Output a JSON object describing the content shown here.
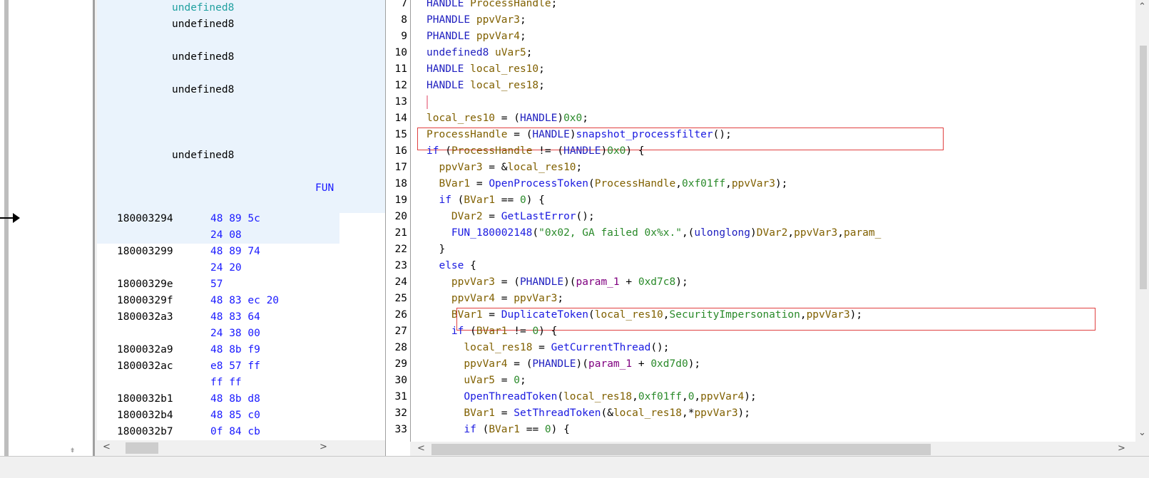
{
  "listing": {
    "rows": [
      {
        "text": "undefined8",
        "kind": "undef",
        "hl": true,
        "colored": true
      },
      {
        "text": "undefined8",
        "kind": "undef",
        "hl": true
      },
      {
        "text": "",
        "kind": "blank",
        "hl": true
      },
      {
        "text": "undefined8",
        "kind": "undef",
        "hl": true
      },
      {
        "text": "",
        "kind": "blank",
        "hl": true
      },
      {
        "text": "undefined8",
        "kind": "undef",
        "hl": true
      },
      {
        "text": "",
        "kind": "blank",
        "hl": true
      },
      {
        "text": "",
        "kind": "blank",
        "hl": true
      },
      {
        "text": "",
        "kind": "blank",
        "hl": true
      },
      {
        "text": "undefined8",
        "kind": "undef",
        "hl": true
      },
      {
        "text": "",
        "kind": "blank",
        "hl": true
      },
      {
        "text": "FUN",
        "kind": "fun",
        "hl": true
      },
      {
        "text": "",
        "kind": "blank",
        "hl": true
      }
    ],
    "instructions": [
      {
        "addr": "180003294",
        "bytes": "48 89 5c",
        "hl": true
      },
      {
        "addr": "",
        "bytes": "24 08",
        "hl": true
      },
      {
        "addr": "180003299",
        "bytes": "48 89 74",
        "hl": false
      },
      {
        "addr": "",
        "bytes": "24 20",
        "hl": false
      },
      {
        "addr": "18000329e",
        "bytes": "57",
        "hl": false
      },
      {
        "addr": "18000329f",
        "bytes": "48 83 ec 20",
        "hl": false
      },
      {
        "addr": "1800032a3",
        "bytes": "48 83 64",
        "hl": false
      },
      {
        "addr": "",
        "bytes": "24 38 00",
        "hl": false
      },
      {
        "addr": "1800032a9",
        "bytes": "48 8b f9",
        "hl": false
      },
      {
        "addr": "1800032ac",
        "bytes": "e8 57 ff",
        "hl": false
      },
      {
        "addr": "",
        "bytes": "ff ff",
        "hl": false
      },
      {
        "addr": "1800032b1",
        "bytes": "48 8b d8",
        "hl": false
      },
      {
        "addr": "1800032b4",
        "bytes": "48 85 c0",
        "hl": false
      },
      {
        "addr": "1800032b7",
        "bytes": "0f 84 cb",
        "hl": false
      }
    ]
  },
  "decompiler": {
    "lines": [
      {
        "n": "7",
        "parts": [
          [
            "t",
            "HANDLE "
          ],
          [
            "v",
            "ProcessHandle"
          ],
          [
            "p",
            ";"
          ]
        ]
      },
      {
        "n": "8",
        "parts": [
          [
            "t",
            "PHANDLE "
          ],
          [
            "v",
            "ppvVar3"
          ],
          [
            "p",
            ";"
          ]
        ]
      },
      {
        "n": "9",
        "parts": [
          [
            "t",
            "PHANDLE "
          ],
          [
            "v",
            "ppvVar4"
          ],
          [
            "p",
            ";"
          ]
        ]
      },
      {
        "n": "10",
        "parts": [
          [
            "t",
            "undefined8 "
          ],
          [
            "v",
            "uVar5"
          ],
          [
            "p",
            ";"
          ]
        ]
      },
      {
        "n": "11",
        "parts": [
          [
            "t",
            "HANDLE "
          ],
          [
            "v",
            "local_res10"
          ],
          [
            "p",
            ";"
          ]
        ]
      },
      {
        "n": "12",
        "parts": [
          [
            "t",
            "HANDLE "
          ],
          [
            "v",
            "local_res18"
          ],
          [
            "p",
            ";"
          ]
        ]
      },
      {
        "n": "13",
        "parts": []
      },
      {
        "n": "14",
        "parts": [
          [
            "v",
            "local_res10"
          ],
          [
            "p",
            " = ("
          ],
          [
            "t",
            "HANDLE"
          ],
          [
            "p",
            ")"
          ],
          [
            "n",
            "0x0"
          ],
          [
            "p",
            ";"
          ]
        ]
      },
      {
        "n": "15",
        "parts": [
          [
            "v",
            "ProcessHandle"
          ],
          [
            "p",
            " = ("
          ],
          [
            "t",
            "HANDLE"
          ],
          [
            "p",
            ")"
          ],
          [
            "f",
            "snapshot_processfilter"
          ],
          [
            "p",
            "();"
          ]
        ]
      },
      {
        "n": "16",
        "parts": [
          [
            "k",
            "if "
          ],
          [
            "p",
            "("
          ],
          [
            "v",
            "ProcessHandle"
          ],
          [
            "p",
            " != ("
          ],
          [
            "t",
            "HANDLE"
          ],
          [
            "p",
            ")"
          ],
          [
            "n",
            "0x0"
          ],
          [
            "p",
            ") {"
          ]
        ]
      },
      {
        "n": "17",
        "parts": [
          [
            "p",
            "  "
          ],
          [
            "v",
            "ppvVar3"
          ],
          [
            "p",
            " = &"
          ],
          [
            "v",
            "local_res10"
          ],
          [
            "p",
            ";"
          ]
        ]
      },
      {
        "n": "18",
        "parts": [
          [
            "p",
            "  "
          ],
          [
            "v",
            "BVar1"
          ],
          [
            "p",
            " = "
          ],
          [
            "f",
            "OpenProcessToken"
          ],
          [
            "p",
            "("
          ],
          [
            "v",
            "ProcessHandle"
          ],
          [
            "p",
            ","
          ],
          [
            "n",
            "0xf01ff"
          ],
          [
            "p",
            ","
          ],
          [
            "v",
            "ppvVar3"
          ],
          [
            "p",
            ");"
          ]
        ]
      },
      {
        "n": "19",
        "parts": [
          [
            "p",
            "  "
          ],
          [
            "k",
            "if "
          ],
          [
            "p",
            "("
          ],
          [
            "v",
            "BVar1"
          ],
          [
            "p",
            " == "
          ],
          [
            "n",
            "0"
          ],
          [
            "p",
            ") {"
          ]
        ]
      },
      {
        "n": "20",
        "parts": [
          [
            "p",
            "    "
          ],
          [
            "v",
            "DVar2"
          ],
          [
            "p",
            " = "
          ],
          [
            "f",
            "GetLastError"
          ],
          [
            "p",
            "();"
          ]
        ]
      },
      {
        "n": "21",
        "parts": [
          [
            "p",
            "    "
          ],
          [
            "f",
            "FUN_180002148"
          ],
          [
            "p",
            "("
          ],
          [
            "s",
            "\"0x02, GA failed 0x%x.\""
          ],
          [
            "p",
            ",("
          ],
          [
            "t",
            "ulonglong"
          ],
          [
            "p",
            ")"
          ],
          [
            "v",
            "DVar2"
          ],
          [
            "p",
            ","
          ],
          [
            "v",
            "ppvVar3"
          ],
          [
            "p",
            ","
          ],
          [
            "v",
            "param_"
          ]
        ]
      },
      {
        "n": "22",
        "parts": [
          [
            "p",
            "  }"
          ]
        ]
      },
      {
        "n": "23",
        "parts": [
          [
            "p",
            "  "
          ],
          [
            "k",
            "else "
          ],
          [
            "p",
            "{"
          ]
        ]
      },
      {
        "n": "24",
        "parts": [
          [
            "p",
            "    "
          ],
          [
            "v",
            "ppvVar3"
          ],
          [
            "p",
            " = ("
          ],
          [
            "t",
            "PHANDLE"
          ],
          [
            "p",
            ")("
          ],
          [
            "pv",
            "param_1"
          ],
          [
            "p",
            " + "
          ],
          [
            "n",
            "0xd7c8"
          ],
          [
            "p",
            ");"
          ]
        ]
      },
      {
        "n": "25",
        "parts": [
          [
            "p",
            "    "
          ],
          [
            "v",
            "ppvVar4"
          ],
          [
            "p",
            " = "
          ],
          [
            "v",
            "ppvVar3"
          ],
          [
            "p",
            ";"
          ]
        ]
      },
      {
        "n": "26",
        "parts": [
          [
            "p",
            "    "
          ],
          [
            "v",
            "BVar1"
          ],
          [
            "p",
            " = "
          ],
          [
            "f",
            "DuplicateToken"
          ],
          [
            "p",
            "("
          ],
          [
            "v",
            "local_res10"
          ],
          [
            "p",
            ","
          ],
          [
            "n",
            "SecurityImpersonation"
          ],
          [
            "p",
            ","
          ],
          [
            "v",
            "ppvVar3"
          ],
          [
            "p",
            ");"
          ]
        ]
      },
      {
        "n": "27",
        "parts": [
          [
            "p",
            "    "
          ],
          [
            "k",
            "if "
          ],
          [
            "p",
            "("
          ],
          [
            "v",
            "BVar1"
          ],
          [
            "p",
            " != "
          ],
          [
            "n",
            "0"
          ],
          [
            "p",
            ") {"
          ]
        ]
      },
      {
        "n": "28",
        "parts": [
          [
            "p",
            "      "
          ],
          [
            "v",
            "local_res18"
          ],
          [
            "p",
            " = "
          ],
          [
            "f",
            "GetCurrentThread"
          ],
          [
            "p",
            "();"
          ]
        ]
      },
      {
        "n": "29",
        "parts": [
          [
            "p",
            "      "
          ],
          [
            "v",
            "ppvVar4"
          ],
          [
            "p",
            " = ("
          ],
          [
            "t",
            "PHANDLE"
          ],
          [
            "p",
            ")("
          ],
          [
            "pv",
            "param_1"
          ],
          [
            "p",
            " + "
          ],
          [
            "n",
            "0xd7d0"
          ],
          [
            "p",
            ");"
          ]
        ]
      },
      {
        "n": "30",
        "parts": [
          [
            "p",
            "      "
          ],
          [
            "v",
            "uVar5"
          ],
          [
            "p",
            " = "
          ],
          [
            "n",
            "0"
          ],
          [
            "p",
            ";"
          ]
        ]
      },
      {
        "n": "31",
        "parts": [
          [
            "p",
            "      "
          ],
          [
            "f",
            "OpenThreadToken"
          ],
          [
            "p",
            "("
          ],
          [
            "v",
            "local_res18"
          ],
          [
            "p",
            ","
          ],
          [
            "n",
            "0xf01ff"
          ],
          [
            "p",
            ","
          ],
          [
            "n",
            "0"
          ],
          [
            "p",
            ","
          ],
          [
            "v",
            "ppvVar4"
          ],
          [
            "p",
            ");"
          ]
        ]
      },
      {
        "n": "32",
        "parts": [
          [
            "p",
            "      "
          ],
          [
            "v",
            "BVar1"
          ],
          [
            "p",
            " = "
          ],
          [
            "f",
            "SetThreadToken"
          ],
          [
            "p",
            "(&"
          ],
          [
            "v",
            "local_res18"
          ],
          [
            "p",
            ",*"
          ],
          [
            "v",
            "ppvVar3"
          ],
          [
            "p",
            ");"
          ]
        ]
      },
      {
        "n": "33",
        "parts": [
          [
            "p",
            "      "
          ],
          [
            "k",
            "if "
          ],
          [
            "p",
            "("
          ],
          [
            "v",
            "BVar1"
          ],
          [
            "p",
            " == "
          ],
          [
            "n",
            "0"
          ],
          [
            "p",
            ") {"
          ]
        ]
      }
    ],
    "highlight_lines": [
      "15",
      "26"
    ]
  },
  "icons": {
    "scroll_up": "▲",
    "scroll_down": "▼",
    "scroll_left": "◀",
    "scroll_right": "▶"
  },
  "colors": {
    "highlight_border": "#e04040",
    "listing_highlight": "#eaf3fc",
    "bookmark": "#f0a830",
    "bookmark_cyan": "#40d8e0"
  }
}
